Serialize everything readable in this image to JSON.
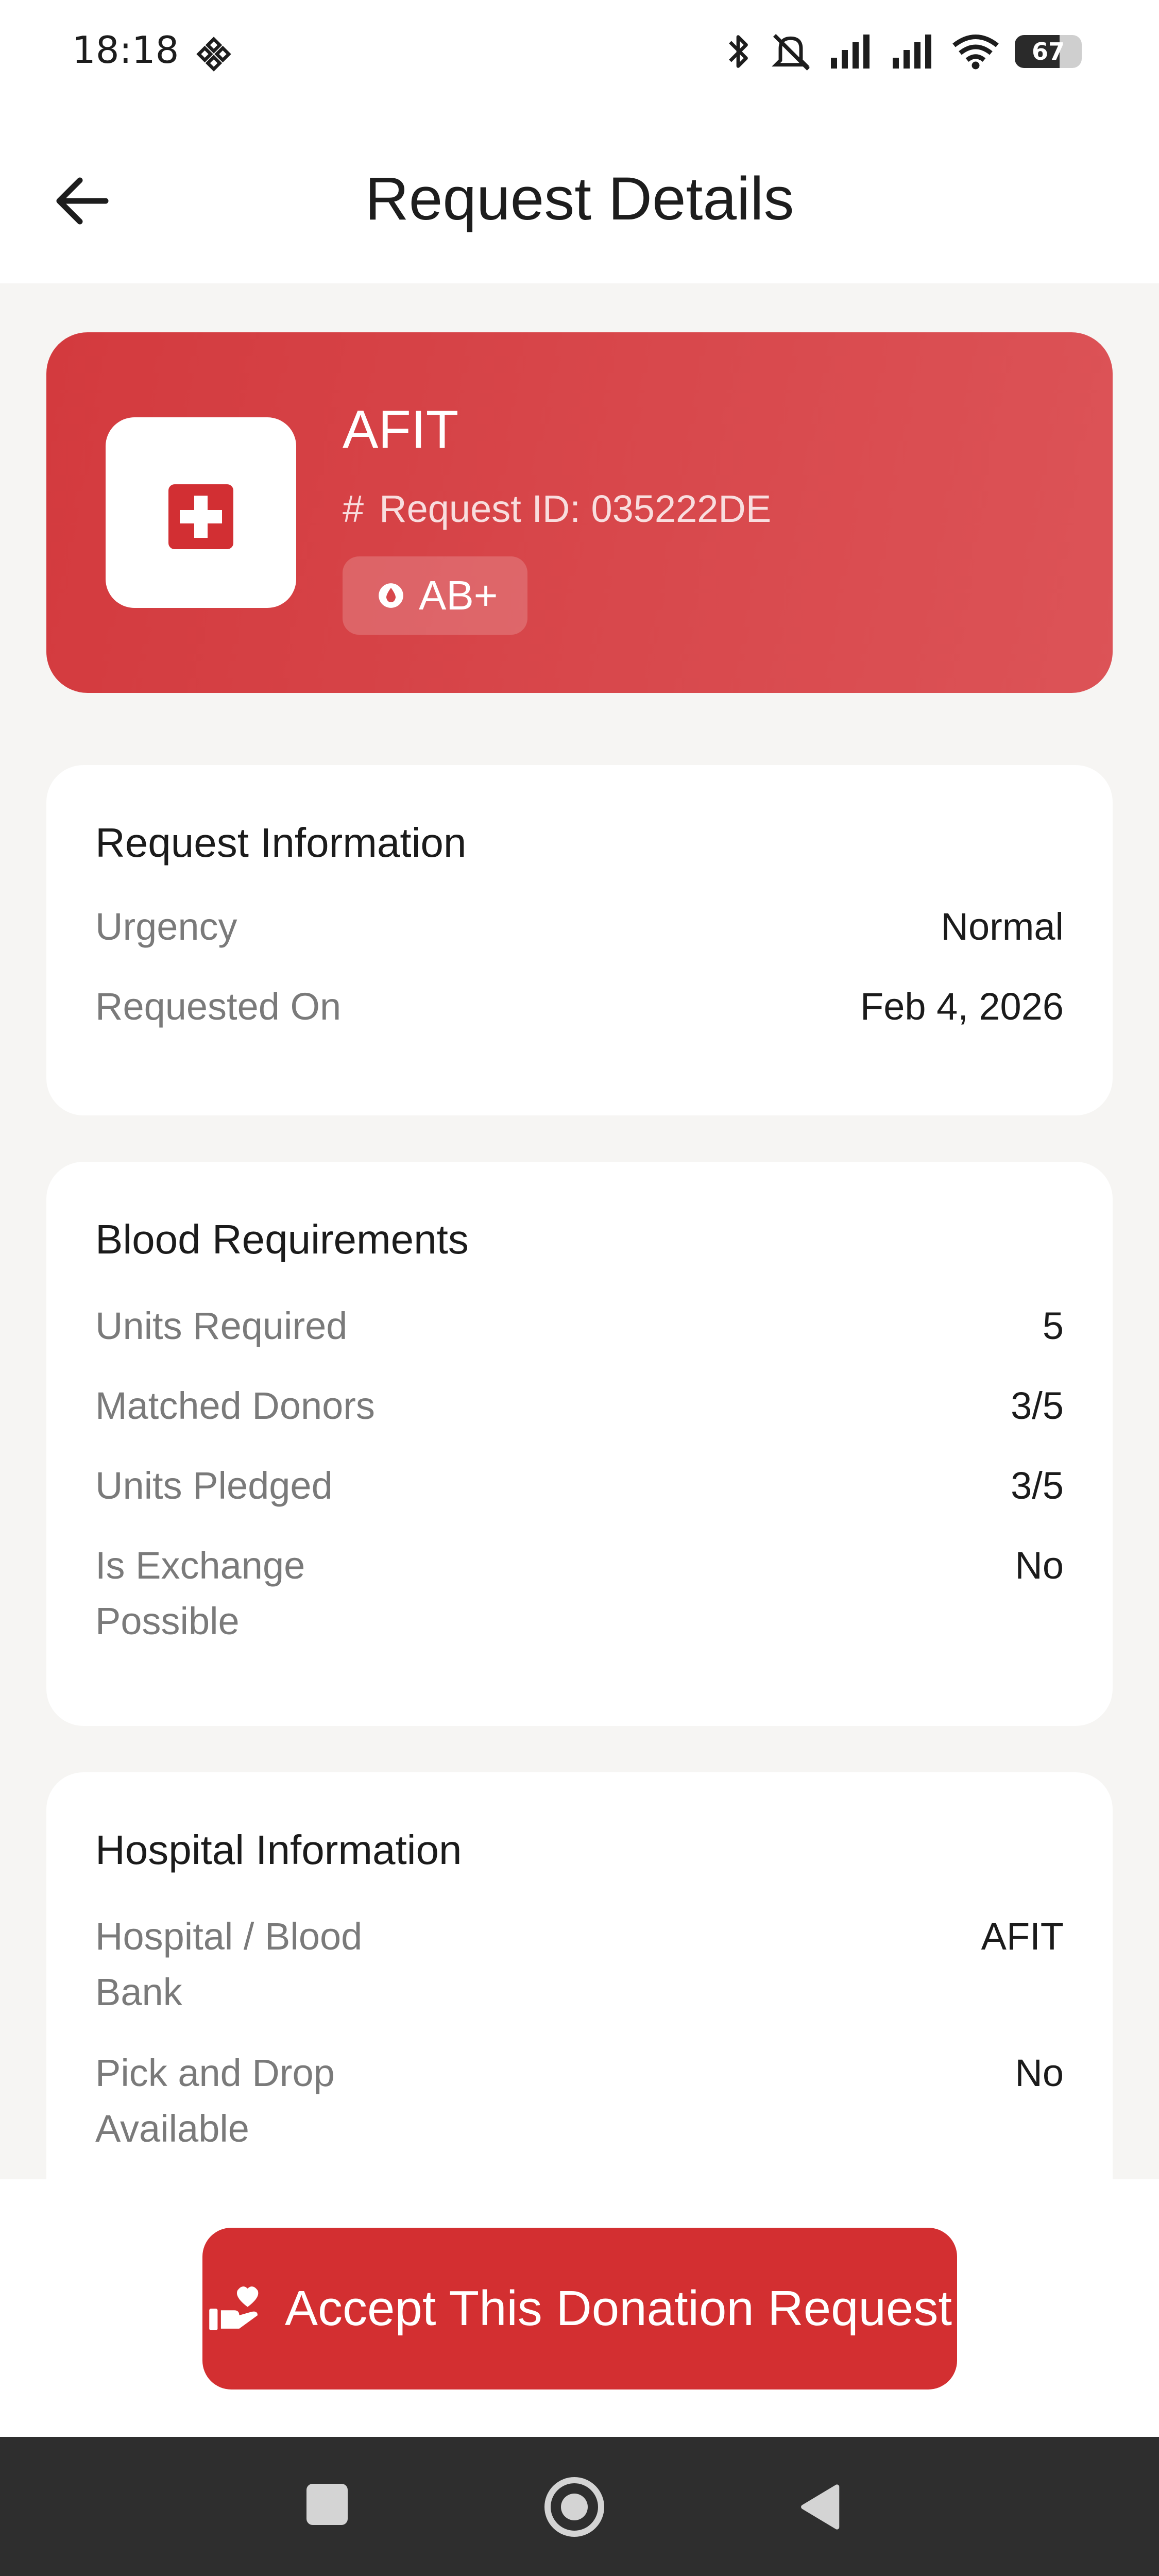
{
  "status_bar": {
    "time": "18:18",
    "battery_level": "67",
    "icons": [
      "binance-icon",
      "bluetooth-icon",
      "mute-icon",
      "signal-icon",
      "signal-icon",
      "wifi-icon",
      "battery-icon"
    ]
  },
  "header": {
    "title": "Request Details",
    "back_icon": "arrow-left-icon"
  },
  "hero": {
    "name": "AFIT",
    "request_id": "Request ID: 035222DE",
    "blood_group": "AB+",
    "colors": {
      "start": "#d33a3e",
      "end": "#dc5357"
    }
  },
  "request_info": {
    "title": "Request Information",
    "rows": [
      {
        "label": "Urgency",
        "value": "Normal"
      },
      {
        "label": "Requested On",
        "value": "Feb 4, 2026"
      }
    ]
  },
  "blood_requirements": {
    "title": "Blood Requirements",
    "rows": [
      {
        "label": "Units Required",
        "value": "5"
      },
      {
        "label": "Matched Donors",
        "value": "3/5"
      },
      {
        "label": "Units Pledged",
        "value": "3/5"
      },
      {
        "label": "Is Exchange Possible",
        "value": "No"
      }
    ]
  },
  "hospital_info": {
    "title": "Hospital Information",
    "rows": [
      {
        "label": "Hospital / Blood Bank",
        "value": "AFIT"
      },
      {
        "label": "Pick and Drop Available",
        "value": "No"
      }
    ]
  },
  "action": {
    "accept_label": "Accept This Donation Request",
    "color": "#d32f31"
  }
}
